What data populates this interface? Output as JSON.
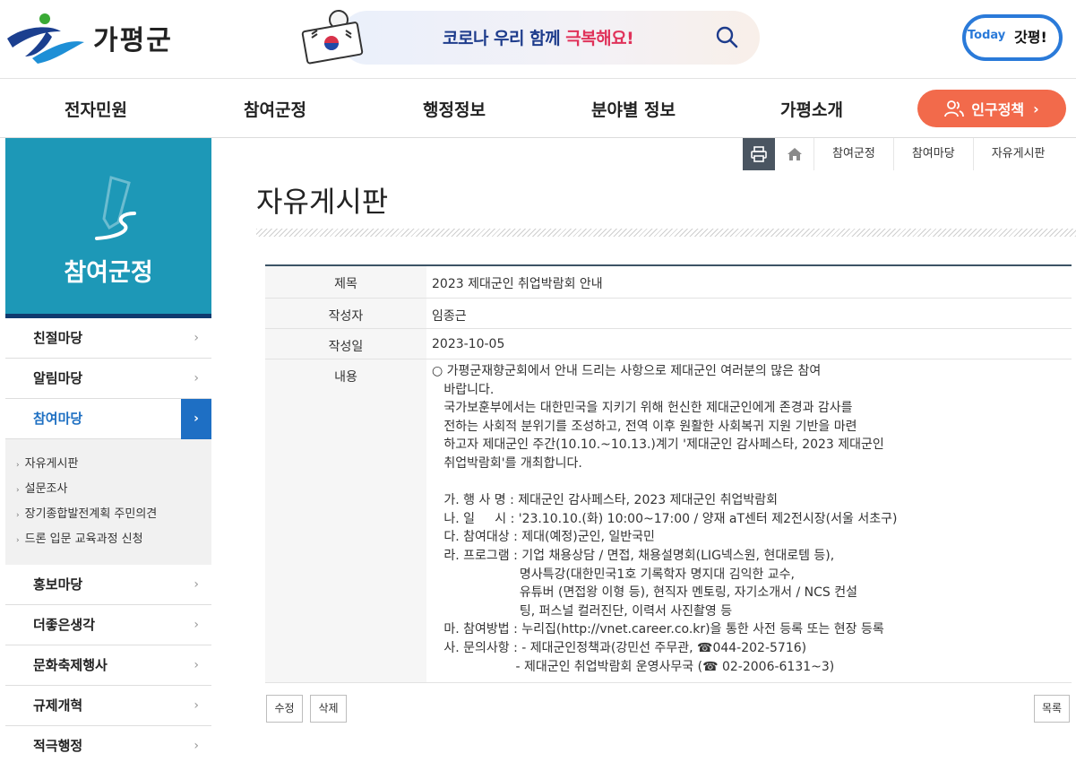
{
  "header": {
    "logo_text": "가평군",
    "banner_text_prefix": "코로나 우리 함께 ",
    "banner_text_highlight": "극복해요!",
    "today_label": "Today",
    "today_brand": "갓평!"
  },
  "gnb": {
    "items": [
      "전자민원",
      "참여군정",
      "행정정보",
      "분야별 정보",
      "가평소개"
    ],
    "special": "인구정책"
  },
  "sidebar": {
    "title": "참여군정",
    "items_top": [
      "친절마당",
      "알림마당"
    ],
    "active": "참여마당",
    "sub_items": [
      "자유게시판",
      "설문조사",
      "장기종합발전계획 주민의견",
      "드론 입문 교육과정 신청"
    ],
    "items_bottom": [
      "홍보마당",
      "더좋은생각",
      "문화축제행사",
      "규제개혁",
      "적극행정"
    ]
  },
  "breadcrumb": [
    "참여군정",
    "참여마당",
    "자유게시판"
  ],
  "page": {
    "title": "자유게시판"
  },
  "post": {
    "labels": {
      "subject": "제목",
      "author": "작성자",
      "date": "작성일",
      "content": "내용"
    },
    "subject": "2023 제대군인 취업박람회 안내",
    "author": "임종근",
    "date": "2023-10-05",
    "content": "○ 가평군재향군회에서 안내 드리는 사항으로 제대군인 여러분의 많은 참여\n   바랍니다.\n   국가보훈부에서는 대한민국을 지키기 위해 헌신한 제대군인에게 존경과 감사를\n   전하는 사회적 분위기를 조성하고, 전역 이후 원활한 사회복귀 지원 기반을 마련\n   하고자 제대군인 주간(10.10.~10.13.)계기 '제대군인 감사페스타, 2023 제대군인\n   취업박람회'를 개최합니다.\n\n   가. 행 사 명 : 제대군인 감사페스타, 2023 제대군인 취업박람회\n   나. 일     시 : '23.10.10.(화) 10:00~17:00 / 양재 aT센터 제2전시장(서울 서초구)\n   다. 참여대상 : 제대(예정)군인, 일반국민\n   라. 프로그램 : 기업 채용상담 / 면접, 채용설명회(LIG넥스원, 현대로템 등),\n                      명사특강(대한민국1호 기록학자 명지대 김익한 교수,\n                      유튜버 (면접왕 이형 등), 현직자 멘토링, 자기소개서 / NCS 컨설\n                      팅, 퍼스널 컬러진단, 이력서 사진촬영 등\n   마. 참여방법 : 누리집(http://vnet.career.co.kr)을 통한 사전 등록 또는 현장 등록\n   사. 문의사항 : - 제대군인정책과(강민선 주무관, ☎044-202-5716)\n                     - 제대군인 취업박람회 운영사무국 (☎ 02-2006-6131~3)"
  },
  "buttons": {
    "edit": "수정",
    "delete": "삭제",
    "list": "목록"
  },
  "colors": {
    "sidebar_hero": "#1d98b7",
    "active_blue": "#1e6fc4",
    "special_orange": "#f26a4b",
    "banner_navy": "#1e3c8c",
    "banner_pink": "#e0325a"
  }
}
